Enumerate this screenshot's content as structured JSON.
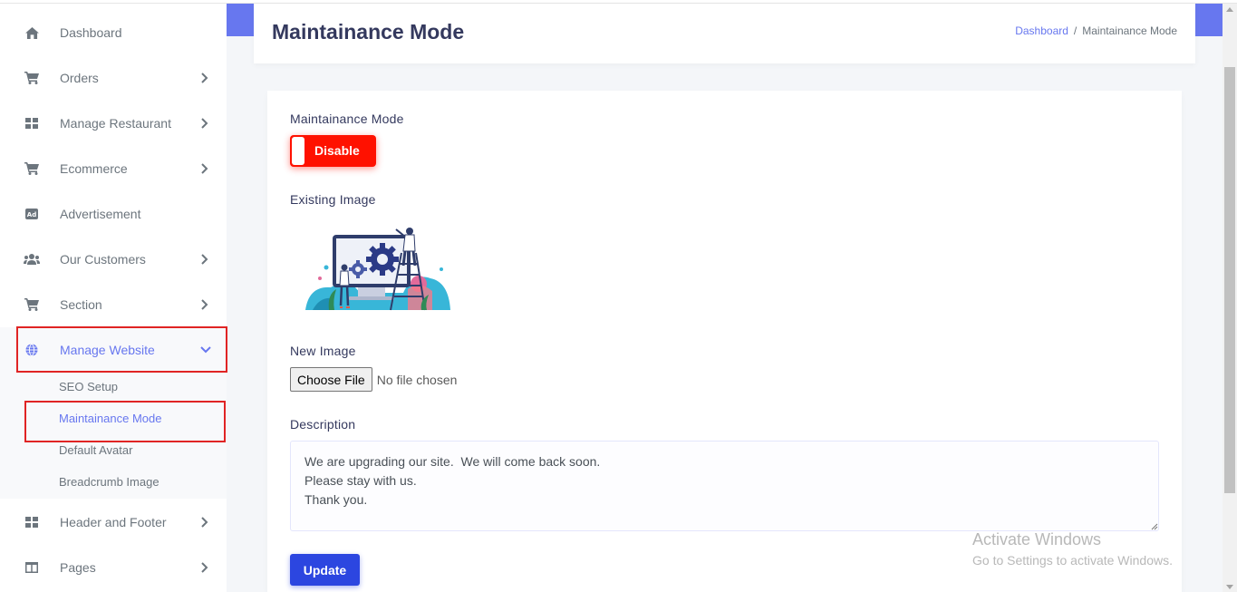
{
  "sidebar": {
    "items": [
      {
        "label": "Dashboard",
        "icon": "home-icon"
      },
      {
        "label": "Orders",
        "icon": "cart-icon"
      },
      {
        "label": "Manage Restaurant",
        "icon": "grid-icon"
      },
      {
        "label": "Ecommerce",
        "icon": "cart-icon"
      },
      {
        "label": "Advertisement",
        "icon": "ad-icon"
      },
      {
        "label": "Our Customers",
        "icon": "users-icon"
      },
      {
        "label": "Section",
        "icon": "cart-icon"
      },
      {
        "label": "Manage Website",
        "icon": "globe-icon"
      },
      {
        "label": "Header and Footer",
        "icon": "grid-icon"
      },
      {
        "label": "Pages",
        "icon": "columns-icon"
      }
    ],
    "submenu": [
      "SEO Setup",
      "Maintainance Mode",
      "Default Avatar",
      "Breadcrumb Image"
    ],
    "active_item": "Manage Website",
    "active_subitem": "Maintainance Mode"
  },
  "header": {
    "title": "Maintainance Mode",
    "breadcrumb": {
      "link": "Dashboard",
      "separator": "/",
      "current": "Maintainance Mode"
    }
  },
  "form": {
    "mode_label": "Maintainance Mode",
    "toggle_text": "Disable",
    "existing_image_label": "Existing Image",
    "new_image_label": "New Image",
    "choose_file": "Choose File",
    "no_file": "No file chosen",
    "description_label": "Description",
    "description": "We are upgrading our site.  We will come back soon.\nPlease stay with us.\nThank you.",
    "update_button": "Update"
  },
  "watermark": {
    "title": "Activate Windows",
    "subtitle": "Go to Settings to activate Windows."
  },
  "colors": {
    "accent": "#6777ef",
    "toggle_off": "#ff1100",
    "primary_button": "#2c46e0",
    "highlight_box": "#e02424"
  }
}
